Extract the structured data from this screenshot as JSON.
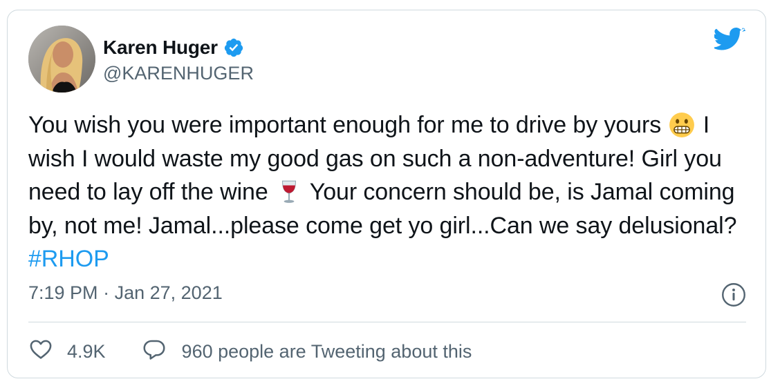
{
  "author": {
    "display_name": "Karen Huger",
    "handle": "@KARENHUGER",
    "verified": true
  },
  "tweet": {
    "text_segments": [
      "You wish you were important enough for me to drive by yours ",
      " I wish I would waste my good gas on such a non-adventure! Girl you need to lay off the wine ",
      " Your concern should be, is Jamal coming by, not me! Jamal...please come get yo girl...Can we say delusional? "
    ],
    "hashtag": "#RHOP",
    "emojis": [
      "grimacing-face-emoji",
      "wine-glass-emoji"
    ]
  },
  "meta": {
    "time": "7:19 PM",
    "separator": "·",
    "date": "Jan 27, 2021"
  },
  "actions": {
    "like_count": "4.9K",
    "reply_label": "960 people are Tweeting about this"
  },
  "colors": {
    "brand_blue": "#1d9bf0",
    "text_primary": "#0f1419",
    "text_secondary": "#536471",
    "border": "#cfd9de"
  },
  "icons": [
    "twitter-bird-icon",
    "verified-badge-icon",
    "info-icon",
    "heart-icon",
    "reply-bubble-icon"
  ]
}
